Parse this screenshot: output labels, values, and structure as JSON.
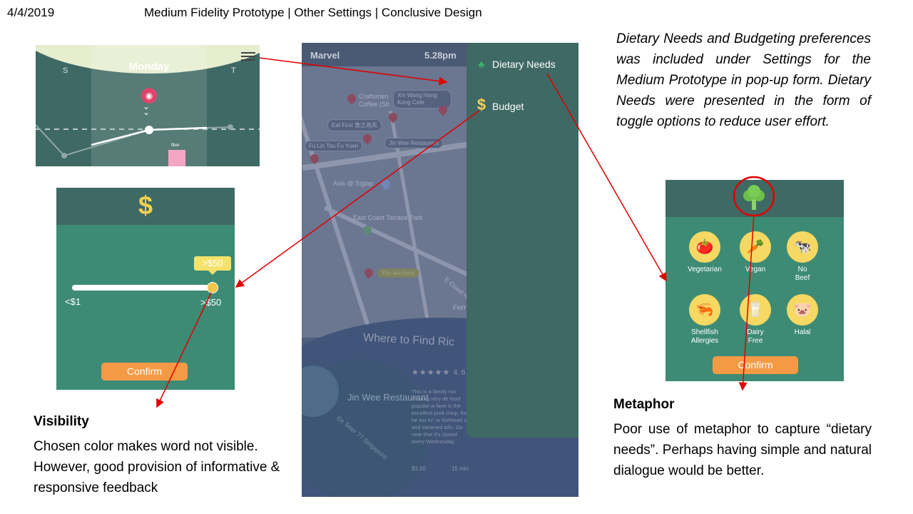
{
  "slide": {
    "date": "4/4/2019",
    "title": "Medium Fidelity Prototype | Other Settings | Conclusive Design"
  },
  "calendar_frame": {
    "day": "Monday",
    "left_letter": "S",
    "right_letter": "T",
    "bar_label": "fiber"
  },
  "budget_frame": {
    "icon": "$",
    "tooltip": ">$50",
    "min_label": "<$1",
    "max_label": ">$50",
    "slider_value": 1.0,
    "confirm_label": "Confirm"
  },
  "map_frame": {
    "carrier": "Marvel",
    "time": "5.28pm",
    "places": [
      "Craftsmen Coffee (Sh",
      "Xin Wang Hong Kong Cafe",
      "Eat First 食之為先",
      "Fu Lin Tou Fu Yuen",
      "Jin Wee Restaurant",
      "Axis @ Siglap",
      "East Coast Terrace Park",
      "You are here"
    ],
    "street": "E Coast Rd",
    "partial_label": "Ferr",
    "sheet_title": "Where to Find Ric",
    "restaurant_name": "Jin Wee Restaurant",
    "restaurant_address": "Ee Teter 77 Singapore",
    "rating_text": "4.6",
    "description": "This is a family run offering very de food popular w fave is the excellent pork chop, fish he tou fu\" or fishhead s and steamed tofu. Do note that it's closed every Wednesday.",
    "price": "$3.50",
    "duration": "15 min",
    "menu_items": [
      {
        "label": "Dietary Needs",
        "icon": "broccoli-icon"
      },
      {
        "label": "Budget",
        "icon": "dollar-icon"
      }
    ]
  },
  "dietary_frame": {
    "options": [
      {
        "label": "Vegetarian",
        "icon": "tomato-icon"
      },
      {
        "label": "Vegan",
        "icon": "carrot-icon"
      },
      {
        "label": "No Beef",
        "icon": "cow-icon"
      },
      {
        "label": "Shellfish Allergies",
        "icon": "shrimp-icon"
      },
      {
        "label": "Dairy Free",
        "icon": "milk-icon"
      },
      {
        "label": "Halal",
        "icon": "pig-icon"
      }
    ],
    "confirm_label": "Confirm"
  },
  "notes": {
    "settings_note": "Dietary Needs and Budgeting preferences was included under Settings for the Medium Prototype in pop-up form. Dietary Needs were presented in the form of toggle options to reduce user effort.",
    "visibility_heading": "Visibility",
    "visibility_text": "Chosen color makes word not visible. However, good provision of informative & responsive feedback",
    "metaphor_heading": "Metaphor",
    "metaphor_text": "Poor use of metaphor to capture “dietary needs”. Perhaps having simple and natural dialogue would be better."
  },
  "colors": {
    "arrow": "#e00000",
    "app_teal": "#3f6964",
    "app_green": "#3d8b75",
    "accent_orange": "#f49a45",
    "accent_yellow": "#f5d14f"
  }
}
